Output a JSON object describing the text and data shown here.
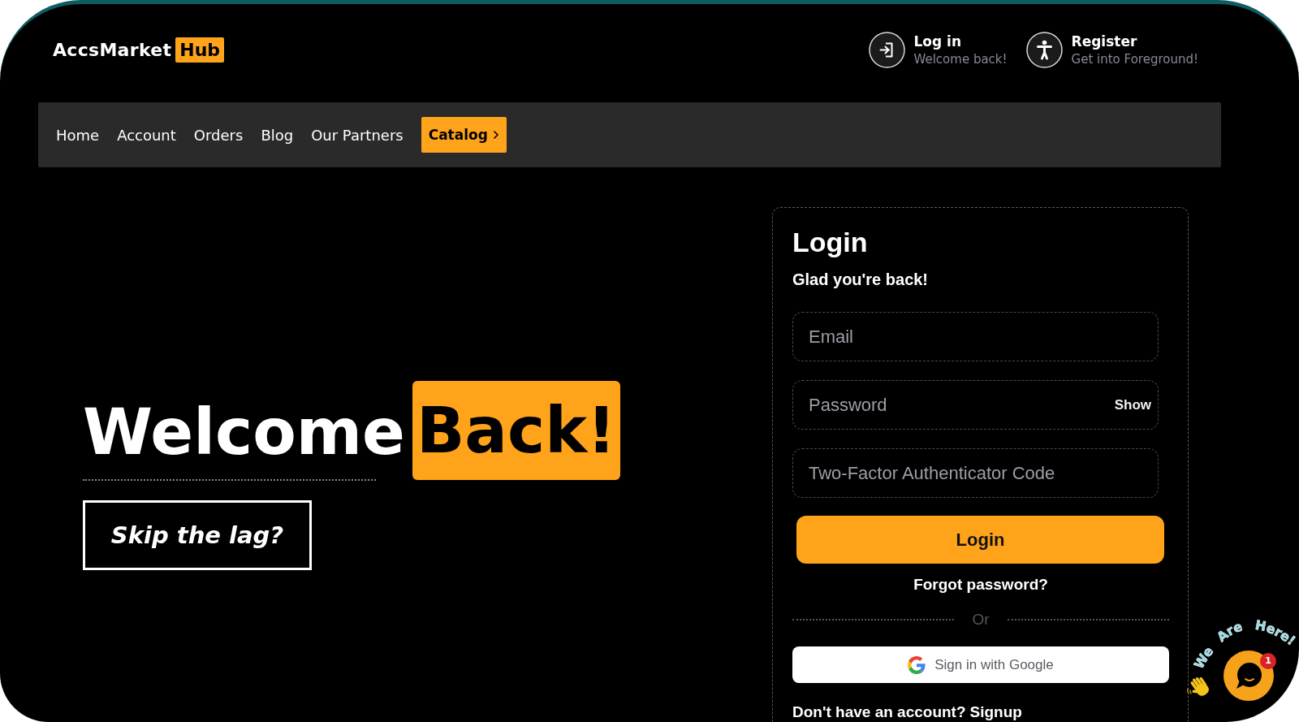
{
  "logo": {
    "text": "AccsMarket",
    "highlight": "Hub"
  },
  "header_links": [
    {
      "kind": "login",
      "title": "Log in",
      "subtitle": "Welcome back!"
    },
    {
      "kind": "register",
      "title": "Register",
      "subtitle": "Get into Foreground!"
    }
  ],
  "nav": {
    "items": [
      {
        "kind": "link",
        "label": "Home"
      },
      {
        "kind": "link",
        "label": "Account"
      },
      {
        "kind": "link",
        "label": "Orders"
      },
      {
        "kind": "link",
        "label": "Blog"
      },
      {
        "kind": "link",
        "label": "Our Partners"
      },
      {
        "kind": "button",
        "label": "Catalog"
      }
    ]
  },
  "hero": {
    "title": "Welcome",
    "highlight": "Back!",
    "button": "Skip the lag?"
  },
  "login_form": {
    "title": "Login",
    "subtitle": "Glad you're back!",
    "fields": [
      {
        "placeholder": "Email"
      },
      {
        "placeholder": "Password",
        "action": "Show"
      },
      {
        "placeholder": "Two-Factor Authenticator Code"
      }
    ],
    "submit": "Login",
    "forgot": "Forgot password?",
    "divider": "Or",
    "google_button": "Sign in with Google",
    "signup_prompt": "Don't have an account?",
    "signup_link": "Signup"
  },
  "chat_widget": {
    "tagline": "We Are Here!",
    "badge": "1"
  }
}
